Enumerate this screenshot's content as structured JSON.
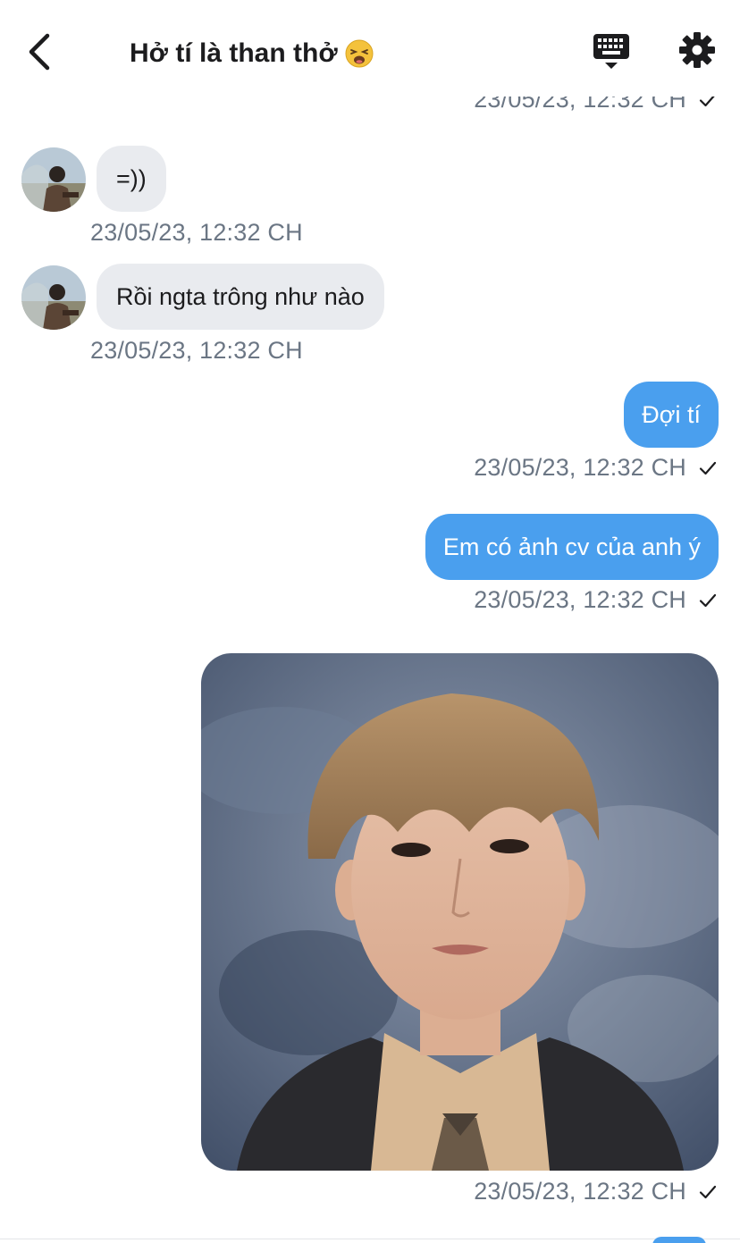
{
  "header": {
    "title": "Hở tí là than thở",
    "emoji_icon": "weary-face-emoji",
    "back_icon": "chevron-left-icon",
    "keyboard_icon": "keyboard-hide-icon",
    "settings_icon": "gear-icon"
  },
  "colors": {
    "outgoing_bubble": "#4a9fee",
    "incoming_bubble": "#e9ebef",
    "timestamp": "#6b7684"
  },
  "messages": [
    {
      "direction": "out",
      "type": "timestamp-only",
      "timestamp": "23/05/23, 12:32 CH",
      "read": true
    },
    {
      "direction": "in",
      "text": "=))",
      "timestamp": "23/05/23, 12:32 CH"
    },
    {
      "direction": "in",
      "text": "Rồi ngta trông như nào",
      "timestamp": "23/05/23, 12:32 CH"
    },
    {
      "direction": "out",
      "text": "Đợi tí",
      "timestamp": "23/05/23, 12:32 CH",
      "read": true
    },
    {
      "direction": "out",
      "text": "Em có ảnh cv của anh ý",
      "timestamp": "23/05/23, 12:32 CH",
      "read": true
    },
    {
      "direction": "out",
      "type": "image",
      "image_desc": "portrait-photo",
      "timestamp": "23/05/23, 12:32 CH",
      "read": true
    }
  ]
}
